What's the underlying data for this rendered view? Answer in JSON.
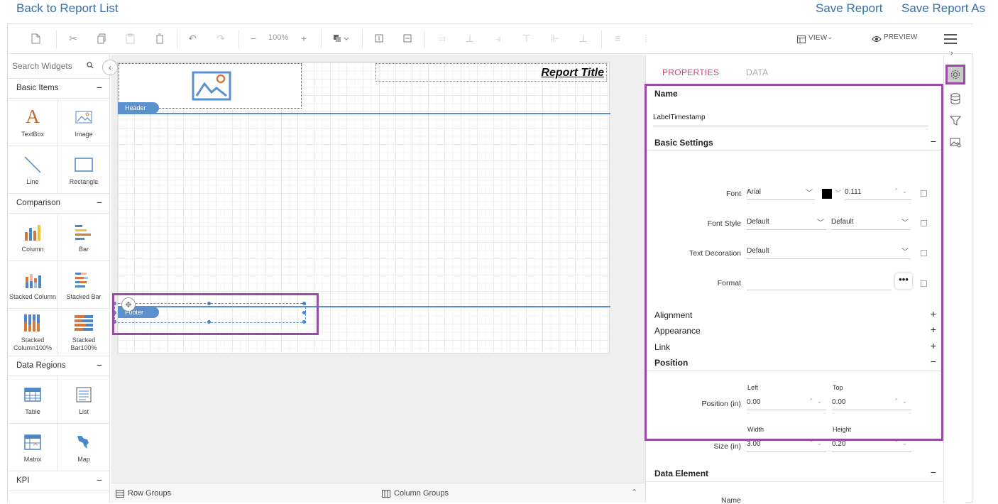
{
  "top_links": {
    "back": "Back to Report List",
    "save": "Save Report",
    "save_as": "Save Report As"
  },
  "toolbar": {
    "zoom": "100%",
    "view_label": "VIEW",
    "preview_label": "PREVIEW"
  },
  "widgets": {
    "search_placeholder": "Search Widgets",
    "categories": [
      {
        "name": "Basic Items",
        "items": [
          "TextBox",
          "Image",
          "Line",
          "Rectangle"
        ]
      },
      {
        "name": "Comparison",
        "items": [
          "Column",
          "Bar",
          "Stacked Column",
          "Stacked Bar",
          "Stacked Column100%",
          "Stacked Bar100%"
        ]
      },
      {
        "name": "Data Regions",
        "items": [
          "Table",
          "List",
          "Matrix",
          "Map"
        ]
      },
      {
        "name": "KPI",
        "items": []
      }
    ]
  },
  "design": {
    "report_title": "Report Title",
    "header_label": "Header",
    "footer_label": "Footer"
  },
  "groups": {
    "row": "Row Groups",
    "column": "Column Groups"
  },
  "properties": {
    "tabs": [
      "PROPERTIES",
      "DATA"
    ],
    "name_label": "Name",
    "name_value": "LabelTimestamp",
    "basic_settings": "Basic Settings",
    "font_label": "Font",
    "font_value": "Arial",
    "font_color": "#000000",
    "font_size": "0.111",
    "font_style_label": "Font Style",
    "font_style_value": "Default",
    "font_weight_value": "Default",
    "text_decoration_label": "Text Decoration",
    "text_decoration_value": "Default",
    "format_label": "Format",
    "format_button": "•••",
    "alignment": "Alignment",
    "appearance": "Appearance",
    "link": "Link",
    "position": "Position",
    "left_label": "Left",
    "top_label": "Top",
    "position_label": "Position (in)",
    "position_left": "0.00",
    "position_top": "0.00",
    "width_label": "Width",
    "height_label": "Height",
    "size_label": "Size (in)",
    "size_width": "3.00",
    "size_height": "0.20",
    "data_element": "Data Element",
    "data_element_name_label": "Name"
  }
}
